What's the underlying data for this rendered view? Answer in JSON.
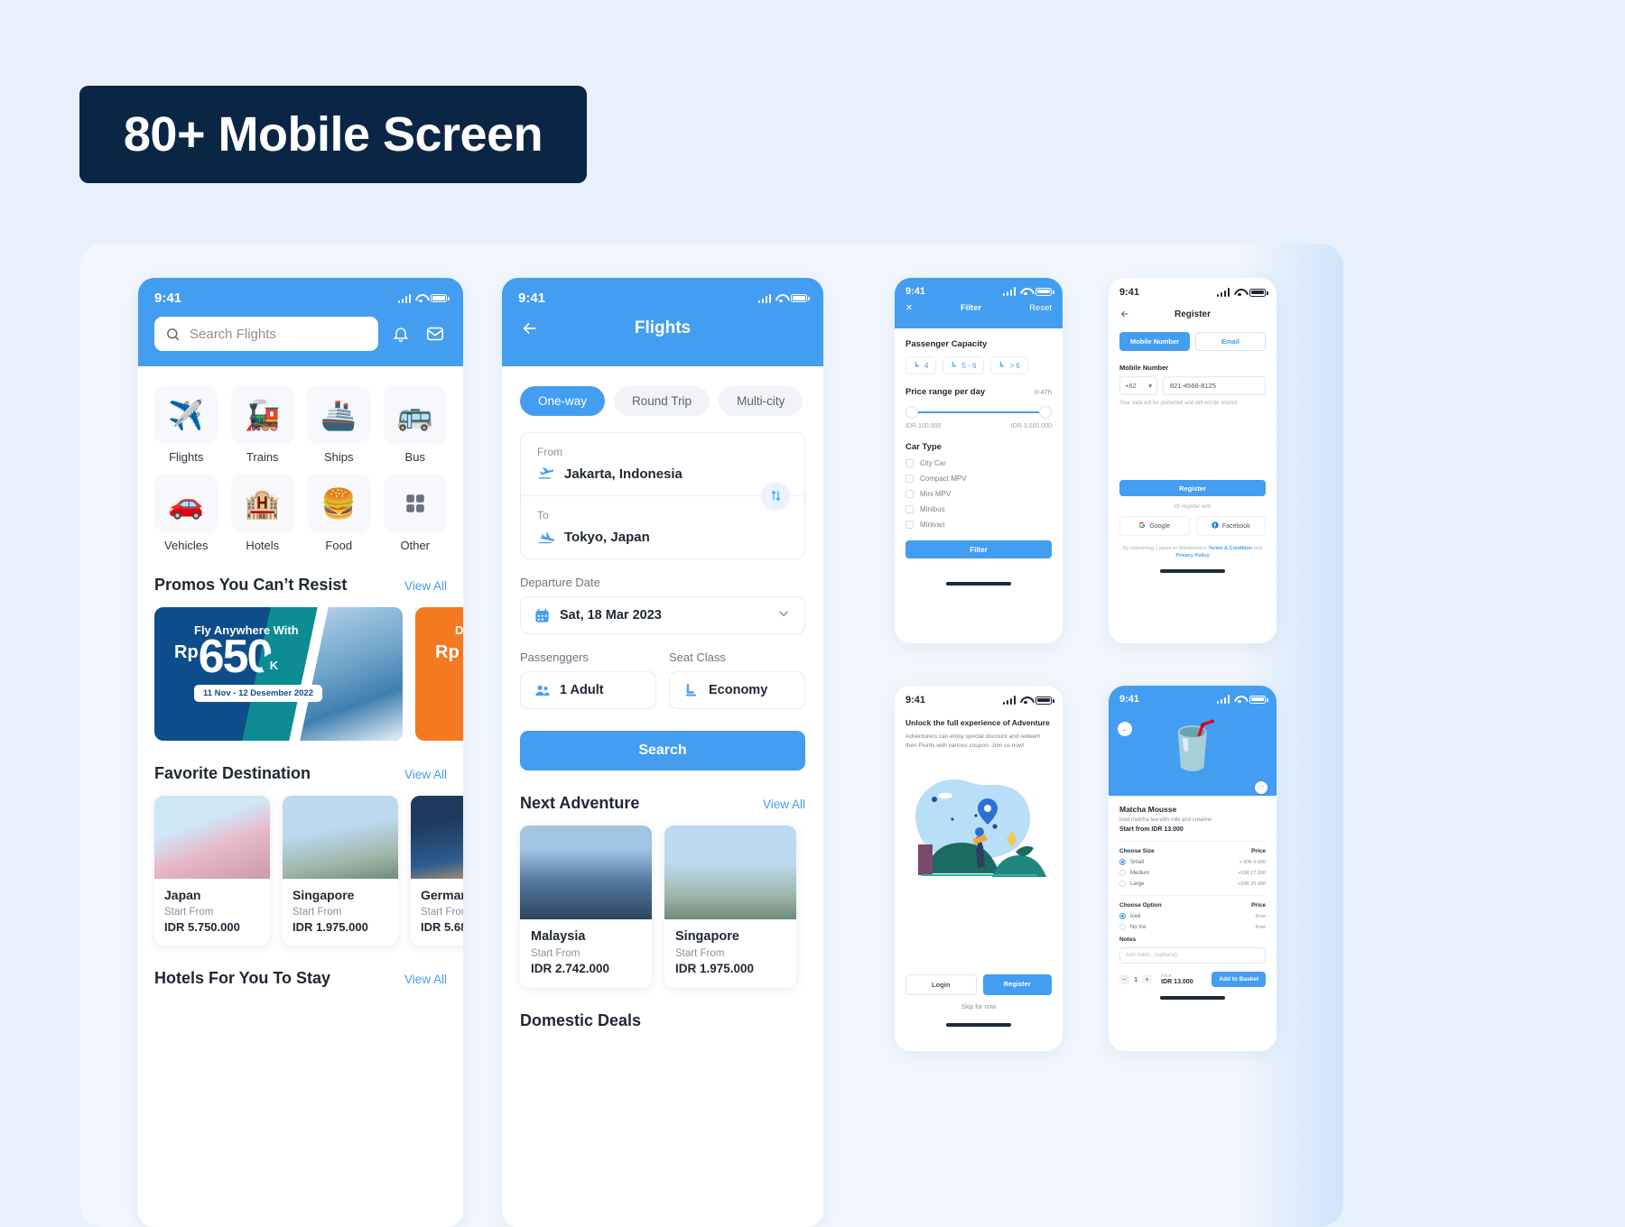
{
  "banner": {
    "title": "80+ Mobile Screen"
  },
  "theme": {
    "primary": "#439df0",
    "navy": "#0b2545",
    "teal": "#0d8c93",
    "orange": "#f47920"
  },
  "home": {
    "status": {
      "time": "9:41"
    },
    "search": {
      "placeholder": "Search Flights",
      "icon": "search-icon"
    },
    "actions": [
      {
        "name": "bell-icon",
        "glyph": "♡"
      },
      {
        "name": "mail-icon",
        "glyph": "✉"
      }
    ],
    "categories": [
      {
        "label": "Flights",
        "glyph": "✈️"
      },
      {
        "label": "Trains",
        "glyph": "🚂"
      },
      {
        "label": "Ships",
        "glyph": "🚢"
      },
      {
        "label": "Bus",
        "glyph": "🚌"
      },
      {
        "label": "Vehicles",
        "glyph": "🚗"
      },
      {
        "label": "Hotels",
        "glyph": "🏨"
      },
      {
        "label": "Food",
        "glyph": "🍔"
      },
      {
        "label": "Other",
        "glyph": "▦"
      }
    ],
    "promos_section": {
      "title": "Promos You Can’t Resist",
      "link": "View All"
    },
    "promos": [
      {
        "kicker": "Fly Anywhere With",
        "currency": "Rp",
        "amount": "650",
        "unit": "K",
        "date": "11 Nov - 12 Desember 2022"
      },
      {
        "kicker": "D",
        "currency": "Rp",
        "amount": "",
        "unit": "",
        "date": ""
      }
    ],
    "favorites_section": {
      "title": "Favorite Destination",
      "link": "View All"
    },
    "destinations": [
      {
        "name": "Japan",
        "from": "Start From",
        "price": "IDR 5.750.000"
      },
      {
        "name": "Singapore",
        "from": "Start From",
        "price": "IDR 1.975.000"
      },
      {
        "name": "German",
        "from": "Start From",
        "price": "IDR 5.68"
      }
    ],
    "hotels_section": {
      "title": "Hotels For You To Stay",
      "link": "View All"
    }
  },
  "flights": {
    "status": {
      "time": "9:41"
    },
    "title": "Flights",
    "back_icon": "arrow-left-icon",
    "trip_tabs": [
      {
        "label": "One-way",
        "active": true
      },
      {
        "label": "Round Trip",
        "active": false
      },
      {
        "label": "Multi-city",
        "active": false
      }
    ],
    "route": {
      "from_label": "From",
      "from_value": "Jakarta, Indonesia",
      "to_label": "To",
      "to_value": "Tokyo, Japan",
      "swap_icon": "swap-vertical-icon"
    },
    "departure": {
      "label": "Departure Date",
      "value": "Sat, 18 Mar 2023",
      "icon": "calendar-icon"
    },
    "passengers": {
      "label": "Passenggers",
      "value": "1 Adult",
      "icon": "people-icon"
    },
    "seat_class": {
      "label": "Seat Class",
      "value": "Economy",
      "icon": "seat-icon"
    },
    "search_button": "Search",
    "adventure_section": {
      "title": "Next Adventure",
      "link": "View All"
    },
    "adventures": [
      {
        "name": "Malaysia",
        "from": "Start From",
        "price": "IDR 2.742.000"
      },
      {
        "name": "Singapore",
        "from": "Start From",
        "price": "IDR 1.975.000"
      }
    ],
    "domestic_section": {
      "title": "Domestic Deals"
    }
  },
  "filter": {
    "status": {
      "time": "9:41"
    },
    "close_icon": "close-icon",
    "title": "Filter",
    "reset": "Reset",
    "capacity": {
      "title": "Passenger Capacity",
      "options": [
        "4",
        "5 - 6",
        "> 6"
      ]
    },
    "price_range": {
      "title": "Price range per day",
      "note": "0-47h",
      "min": "IDR 100.000",
      "max": "IDR 3.000.000"
    },
    "car_type": {
      "title": "Car Type",
      "options": [
        "City Car",
        "Compact MPV",
        "Mini MPV",
        "Minibus",
        "Minivan"
      ]
    },
    "apply_button": "Filter"
  },
  "register": {
    "status": {
      "time": "9:41"
    },
    "back_icon": "arrow-left-icon",
    "title": "Register",
    "methods": [
      {
        "label": "Mobile Number",
        "active": true
      },
      {
        "label": "Email",
        "active": false
      }
    ],
    "mobile_label": "Mobile Number",
    "country_code": "+62",
    "number": "821-4568-8125",
    "hint": "Your data will be protected and will not be shared",
    "register_button": "Register",
    "or_text": "Or register with",
    "socials": [
      {
        "label": "Google",
        "icon": "google-icon"
      },
      {
        "label": "Facebook",
        "icon": "facebook-icon"
      }
    ],
    "terms_prefix": "By registering, I agree to Wanderlust’s ",
    "terms_link": "Terms & Condition",
    "terms_mid": " and ",
    "privacy_link": "Privacy Policy"
  },
  "onboarding": {
    "status": {
      "time": "9:41"
    },
    "heading": "Unlock the full experience of Adventure",
    "body": "Adventurers can enjoy special discount and redeem their Points with various coupon. Join us now!",
    "login_button": "Login",
    "register_button": "Register",
    "skip": "Skip for now"
  },
  "product": {
    "status": {
      "time": "9:41"
    },
    "back_icon": "arrow-left-icon",
    "favorite_icon": "heart-icon",
    "name": "Matcha Mousse",
    "description": "Iced matcha tea with milk and creamer",
    "start_price": "Start from IDR 13.000",
    "size_section": {
      "title": "Choose Size",
      "price_col": "Price"
    },
    "sizes": [
      {
        "label": "Small",
        "price": "+ IDR 0.000",
        "selected": true
      },
      {
        "label": "Medium",
        "price": "+IDR 17.000",
        "selected": false
      },
      {
        "label": "Large",
        "price": "+IDR 20.000",
        "selected": false
      }
    ],
    "option_section": {
      "title": "Choose Option",
      "price_col": "Price"
    },
    "options": [
      {
        "label": "Iced",
        "price": "Free",
        "selected": true
      },
      {
        "label": "No Ice",
        "price": "Free",
        "selected": false
      }
    ],
    "notes_title": "Notes",
    "notes_placeholder": "Add notes.. (optional)",
    "quantity": "1",
    "price_caption": "Price",
    "price_value": "IDR 13.000",
    "add_button": "Add to Basket"
  }
}
